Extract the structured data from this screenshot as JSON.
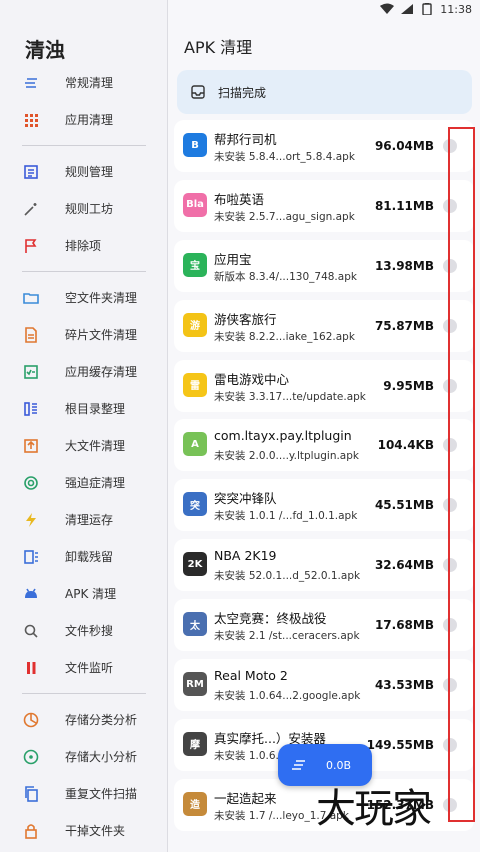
{
  "status_bar": {
    "time": "11:38"
  },
  "drawer": {
    "title": "清浊",
    "groups": [
      [
        {
          "label": "常规清理",
          "icon": "lines-icon",
          "color": "#3b6fd9"
        },
        {
          "label": "应用清理",
          "icon": "grid-icon",
          "color": "#e0542b"
        }
      ],
      [
        {
          "label": "规则管理",
          "icon": "list-box-icon",
          "color": "#3b5bd9"
        },
        {
          "label": "规则工坊",
          "icon": "magic-wand-icon",
          "color": "#5a5a5a"
        },
        {
          "label": "排除项",
          "icon": "flag-icon",
          "color": "#e03030"
        }
      ],
      [
        {
          "label": "空文件夹清理",
          "icon": "folder-icon",
          "color": "#3b8bd9"
        },
        {
          "label": "碎片文件清理",
          "icon": "document-icon",
          "color": "#e07830"
        },
        {
          "label": "应用缓存清理",
          "icon": "checklist-icon",
          "color": "#2aa06a"
        },
        {
          "label": "根目录整理",
          "icon": "columns-icon",
          "color": "#3b5bd9"
        },
        {
          "label": "大文件清理",
          "icon": "upload-box-icon",
          "color": "#e07830"
        },
        {
          "label": "强迫症清理",
          "icon": "target-icon",
          "color": "#2aa06a"
        },
        {
          "label": "清理运存",
          "icon": "lightning-icon",
          "color": "#e8b820"
        },
        {
          "label": "卸载残留",
          "icon": "uninstall-icon",
          "color": "#3b6fd9"
        },
        {
          "label": "APK 清理",
          "icon": "android-icon",
          "color": "#3b6fd9"
        },
        {
          "label": "文件秒搜",
          "icon": "search-icon",
          "color": "#5a5a5a"
        },
        {
          "label": "文件监听",
          "icon": "pause-icon",
          "color": "#e03030"
        }
      ],
      [
        {
          "label": "存储分类分析",
          "icon": "pie-chart-icon",
          "color": "#e07830"
        },
        {
          "label": "存储大小分析",
          "icon": "dot-circle-icon",
          "color": "#2aa06a"
        },
        {
          "label": "重复文件扫描",
          "icon": "copy-icon",
          "color": "#3b6fd9"
        },
        {
          "label": "干掉文件夹",
          "icon": "lock-icon",
          "color": "#e07830"
        }
      ]
    ]
  },
  "main": {
    "title": "APK 清理",
    "scan_status": "扫描完成",
    "apks": [
      {
        "name": "帮邦行司机",
        "sub": "未安装 5.8.4...ort_5.8.4.apk",
        "size": "96.04MB",
        "icon_color": "#1e7be0",
        "icon_text": "B"
      },
      {
        "name": "布啦英语",
        "sub": "未安装 2.5.7...agu_sign.apk",
        "size": "81.11MB",
        "icon_color": "#f06fa8",
        "icon_text": "Bla"
      },
      {
        "name": "应用宝",
        "sub": "新版本 8.3.4/...130_748.apk",
        "size": "13.98MB",
        "icon_color": "#2bb35a",
        "icon_text": "宝"
      },
      {
        "name": "游侠客旅行",
        "sub": "未安装 8.2.2...iake_162.apk",
        "size": "75.87MB",
        "icon_color": "#f3c316",
        "icon_text": "游"
      },
      {
        "name": "雷电游戏中心",
        "sub": "未安装 3.3.17...te/update.apk",
        "size": "9.95MB",
        "icon_color": "#f5c518",
        "icon_text": "雷"
      },
      {
        "name": "com.ltayx.pay.ltplugin",
        "sub": "未安装 2.0.0....y.ltplugin.apk",
        "size": "104.4KB",
        "icon_color": "#78c257",
        "icon_text": "A"
      },
      {
        "name": "突突冲锋队",
        "sub": "未安装 1.0.1 /...fd_1.0.1.apk",
        "size": "45.51MB",
        "icon_color": "#3a6fc4",
        "icon_text": "突"
      },
      {
        "name": "NBA 2K19",
        "sub": "未安装 52.0.1...d_52.0.1.apk",
        "size": "32.64MB",
        "icon_color": "#2a2a2a",
        "icon_text": "2K"
      },
      {
        "name": "太空竞赛：终极战役",
        "sub": "未安装 2.1 /st...ceracers.apk",
        "size": "17.68MB",
        "icon_color": "#4a6fb0",
        "icon_text": "太"
      },
      {
        "name": "Real Moto 2",
        "sub": "未安装 1.0.64...2.google.apk",
        "size": "43.53MB",
        "icon_color": "#555555",
        "icon_text": "RM"
      },
      {
        "name": "真实摩托...）安装器",
        "sub": "未安装 1.0.6...",
        "size": "149.55MB",
        "icon_color": "#444444",
        "icon_text": "摩"
      },
      {
        "name": "一起造起来",
        "sub": "未安装 1.7 /...leyo_1.7.apk",
        "size": "152.37MB",
        "icon_color": "#c58a3a",
        "icon_text": "造"
      }
    ]
  },
  "fab": {
    "label": "0.0B"
  },
  "watermark": "大玩家"
}
